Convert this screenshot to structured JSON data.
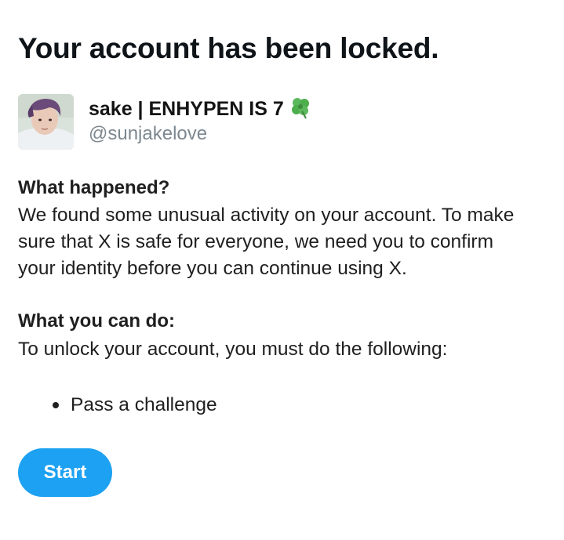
{
  "page": {
    "title": "Your account has been locked."
  },
  "profile": {
    "display_name": "sake | ENHYPEN IS 7",
    "handle": "@sunjakelove",
    "name_emoji_icon": "four-leaf-clover-icon",
    "avatar": "user-avatar-photo"
  },
  "what_happened": {
    "heading": "What happened?",
    "body": "We found some unusual activity on your account. To make sure that X is safe for everyone, we need you to confirm your identity before you can continue using X."
  },
  "what_you_can_do": {
    "heading": "What you can do:",
    "body": "To unlock your account, you must do the following:",
    "steps": [
      "Pass a challenge"
    ]
  },
  "actions": {
    "start_label": "Start"
  },
  "colors": {
    "accent": "#1da1f2",
    "secondary_text": "#7d8890",
    "primary_text": "#0f1419"
  }
}
